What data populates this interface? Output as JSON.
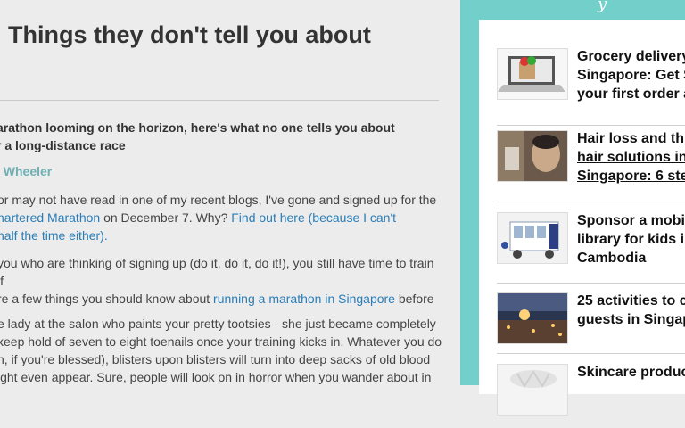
{
  "article": {
    "title": "Things they don't tell you about",
    "subtitle_line1": "arathon looming on the horizon, here's what no one tells you about",
    "subtitle_line2": "r a long-distance race",
    "author": "l Wheeler",
    "p1": {
      "t1": " or may not have read in one of my recent blogs, I've gone and signed up for the",
      "link1": "hartered Marathon",
      "t2": " on December 7. Why? ",
      "link2a": "Find out here (because I can't",
      "link2b": "half the time either)."
    },
    "p2": {
      "t1": "you who are thinking of signing up (do it, do it, do it!), you still have time to train if",
      "t2": "re a few things you should know about ",
      "link": "running a marathon in Singapore",
      "t3": " before"
    },
    "p3": {
      "l1": "e lady at the salon who paints your pretty tootsies - she just became completely",
      "l2": "keep hold of seven to eight toenails once your training kicks in. Whatever you do",
      "l3": "n, if you're blessed), blisters upon blisters will turn into deep sacks of old blood",
      "l4": "ight even appear. Sure, people will look on in horror when you wander about in"
    }
  },
  "sidebar": {
    "items": [
      {
        "lines": [
          "Grocery delivery",
          "Singapore: Get S",
          "your first order a"
        ],
        "underline": false,
        "icon": "laptop-groceries"
      },
      {
        "lines": [
          "Hair loss and th",
          "hair solutions in",
          "Singapore: 6 ste"
        ],
        "underline": true,
        "icon": "hair-treatment"
      },
      {
        "lines": [
          "Sponsor a mobi",
          "library for kids i",
          "Cambodia"
        ],
        "underline": false,
        "icon": "library-vehicle"
      },
      {
        "lines": [
          "25 activities to c",
          "guests in Singap"
        ],
        "underline": false,
        "icon": "city-night"
      },
      {
        "lines": [
          "Skincare produc"
        ],
        "underline": false,
        "icon": "skincare"
      }
    ]
  }
}
